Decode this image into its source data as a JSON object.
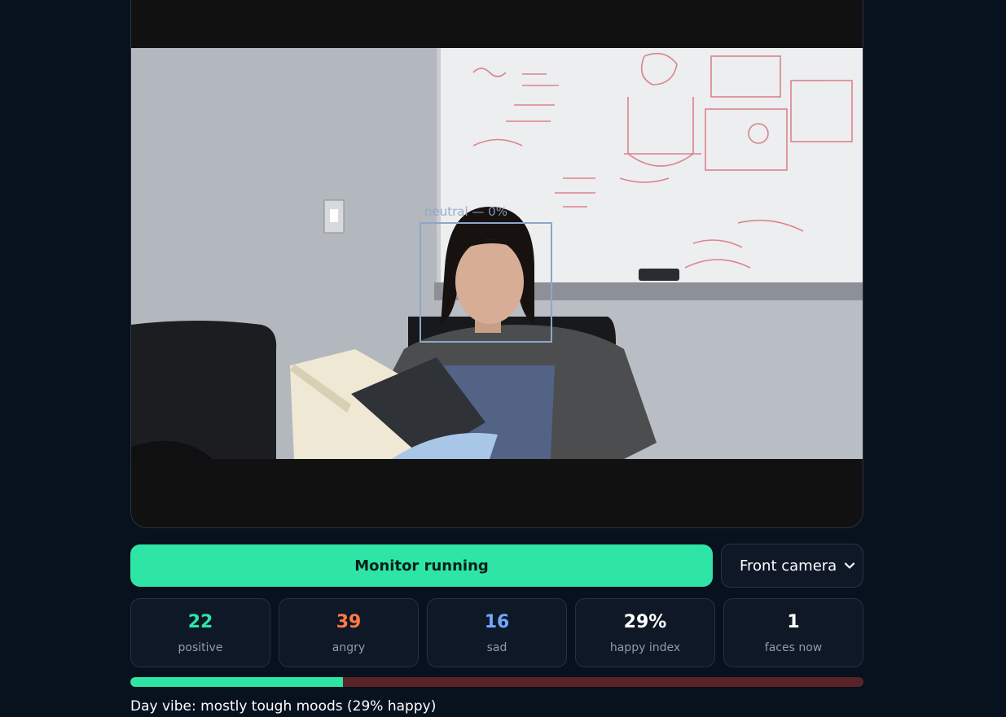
{
  "video": {
    "detection_label": "neutral — 0%"
  },
  "controls": {
    "monitor_label": "Monitor running",
    "camera_selected": "Front camera"
  },
  "stats": [
    {
      "value": "22",
      "label": "positive",
      "color": "#2ee5a6"
    },
    {
      "value": "39",
      "label": "angry",
      "color": "#ff7a45"
    },
    {
      "value": "16",
      "label": "sad",
      "color": "#6fa8ff"
    },
    {
      "value": "29%",
      "label": "happy index",
      "color": "#ffffff"
    },
    {
      "value": "1",
      "label": "faces now",
      "color": "#ffffff"
    }
  ],
  "happy_meter": {
    "fraction": 0.29,
    "fill_color": "#2ee5a6",
    "track_color": "#5a2327"
  },
  "vibe_text": "Day vibe: mostly tough moods (29% happy)",
  "icons": {
    "camera_select": "chevron-down-icon"
  }
}
